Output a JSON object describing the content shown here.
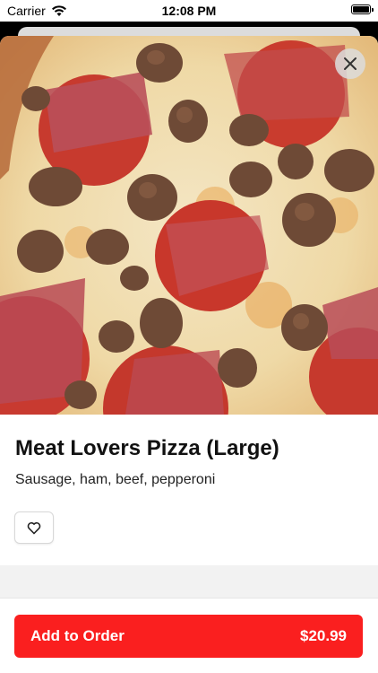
{
  "status_bar": {
    "carrier": "Carrier",
    "time": "12:08 PM"
  },
  "item": {
    "name": "Meat Lovers Pizza (Large)",
    "description": "Sausage, ham, beef, pepperoni"
  },
  "order_button": {
    "label": "Add to Order",
    "price": "$20.99"
  },
  "colors": {
    "accent": "#fa1f1f"
  },
  "icons": {
    "close": "close-icon",
    "favorite": "heart-icon"
  }
}
